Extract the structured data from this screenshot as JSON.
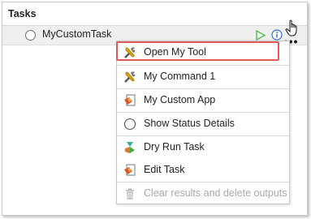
{
  "panel": {
    "title": "Tasks"
  },
  "task": {
    "name": "MyCustomTask"
  },
  "menu": {
    "items": [
      {
        "label": "Open My Tool",
        "icon": "tools-icon",
        "enabled": true
      },
      {
        "label": "My Command 1",
        "icon": "tools-icon",
        "enabled": true
      },
      {
        "label": "My Custom App",
        "icon": "app-icon",
        "enabled": true
      },
      {
        "label": "Show Status Details",
        "icon": "status-circle-icon",
        "enabled": true
      },
      {
        "label": "Dry Run Task",
        "icon": "dry-run-icon",
        "enabled": true
      },
      {
        "label": "Edit Task",
        "icon": "edit-task-icon",
        "enabled": true
      },
      {
        "label": "Clear results and delete outputs",
        "icon": "trash-icon",
        "enabled": false
      }
    ]
  },
  "colors": {
    "highlight_border": "#e05a5a",
    "run_green": "#3cb043",
    "info_blue": "#2f6fd1"
  }
}
